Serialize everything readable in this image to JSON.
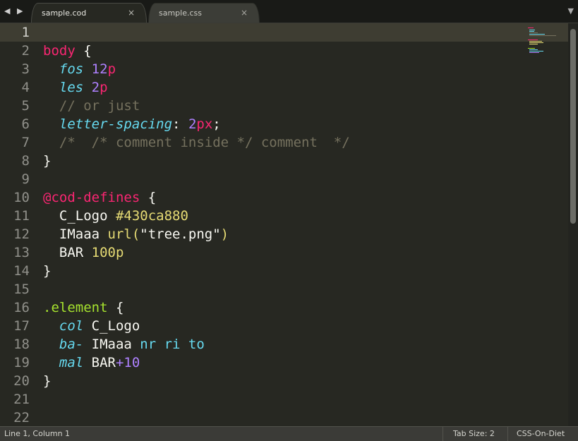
{
  "tabs": [
    {
      "label": "sample.cod",
      "active": true,
      "close": "×"
    },
    {
      "label": "sample.css",
      "active": false,
      "close": "×"
    }
  ],
  "nav": {
    "arrows": "◀ ▶",
    "menu": "▼"
  },
  "editor": {
    "current_line": 1,
    "line_numbers": [
      "1",
      "2",
      "3",
      "4",
      "5",
      "6",
      "7",
      "8",
      "9",
      "10",
      "11",
      "12",
      "13",
      "14",
      "15",
      "16",
      "17",
      "18",
      "19",
      "20",
      "21",
      "22"
    ],
    "lines": [
      [],
      [
        {
          "t": "body",
          "c": "sel"
        },
        {
          "t": " {",
          "c": "plain"
        }
      ],
      [
        {
          "t": "  ",
          "c": "plain"
        },
        {
          "t": "fos",
          "c": "prop"
        },
        {
          "t": " ",
          "c": "plain"
        },
        {
          "t": "12",
          "c": "num"
        },
        {
          "t": "p",
          "c": "unit"
        }
      ],
      [
        {
          "t": "  ",
          "c": "plain"
        },
        {
          "t": "les",
          "c": "prop"
        },
        {
          "t": " ",
          "c": "plain"
        },
        {
          "t": "2",
          "c": "num"
        },
        {
          "t": "p",
          "c": "unit"
        }
      ],
      [
        {
          "t": "  // or just",
          "c": "comment"
        }
      ],
      [
        {
          "t": "  ",
          "c": "plain"
        },
        {
          "t": "letter-spacing",
          "c": "prop"
        },
        {
          "t": ": ",
          "c": "plain"
        },
        {
          "t": "2",
          "c": "num"
        },
        {
          "t": "px",
          "c": "unit"
        },
        {
          "t": ";",
          "c": "plain"
        }
      ],
      [
        {
          "t": "  /*  /* comment inside */ comment  */",
          "c": "comment"
        }
      ],
      [
        {
          "t": "}",
          "c": "plain"
        }
      ],
      [],
      [
        {
          "t": "@cod-defines",
          "c": "sel"
        },
        {
          "t": " {",
          "c": "plain"
        }
      ],
      [
        {
          "t": "  C_Logo ",
          "c": "plain"
        },
        {
          "t": "#430ca880",
          "c": "value"
        }
      ],
      [
        {
          "t": "  IMaaa ",
          "c": "plain"
        },
        {
          "t": "url(",
          "c": "value"
        },
        {
          "t": "\"tree.png\"",
          "c": "plain"
        },
        {
          "t": ")",
          "c": "value"
        }
      ],
      [
        {
          "t": "  BAR ",
          "c": "plain"
        },
        {
          "t": "100p",
          "c": "value"
        }
      ],
      [
        {
          "t": "}",
          "c": "plain"
        }
      ],
      [],
      [
        {
          "t": ".element",
          "c": "class"
        },
        {
          "t": " {",
          "c": "plain"
        }
      ],
      [
        {
          "t": "  ",
          "c": "plain"
        },
        {
          "t": "col",
          "c": "prop"
        },
        {
          "t": " C_Logo",
          "c": "plain"
        }
      ],
      [
        {
          "t": "  ",
          "c": "plain"
        },
        {
          "t": "ba-",
          "c": "prop"
        },
        {
          "t": " IMaaa ",
          "c": "plain"
        },
        {
          "t": "nr ri to",
          "c": "kw"
        }
      ],
      [
        {
          "t": "  ",
          "c": "plain"
        },
        {
          "t": "mal",
          "c": "prop"
        },
        {
          "t": " BAR",
          "c": "plain"
        },
        {
          "t": "+10",
          "c": "num"
        }
      ],
      [
        {
          "t": "}",
          "c": "plain"
        }
      ],
      [],
      []
    ]
  },
  "status": {
    "position": "Line 1, Column 1",
    "tab_size": "Tab Size: 2",
    "syntax": "CSS-On-Diet"
  },
  "colors": {
    "background": "#272822",
    "selector": "#f92672",
    "property": "#66d9ef",
    "number": "#ae81ff",
    "comment": "#75715e",
    "value": "#e6db74",
    "class": "#a6e22e"
  },
  "icons": [
    "left-arrow-icon",
    "right-arrow-icon",
    "close-icon",
    "dropdown-icon"
  ]
}
